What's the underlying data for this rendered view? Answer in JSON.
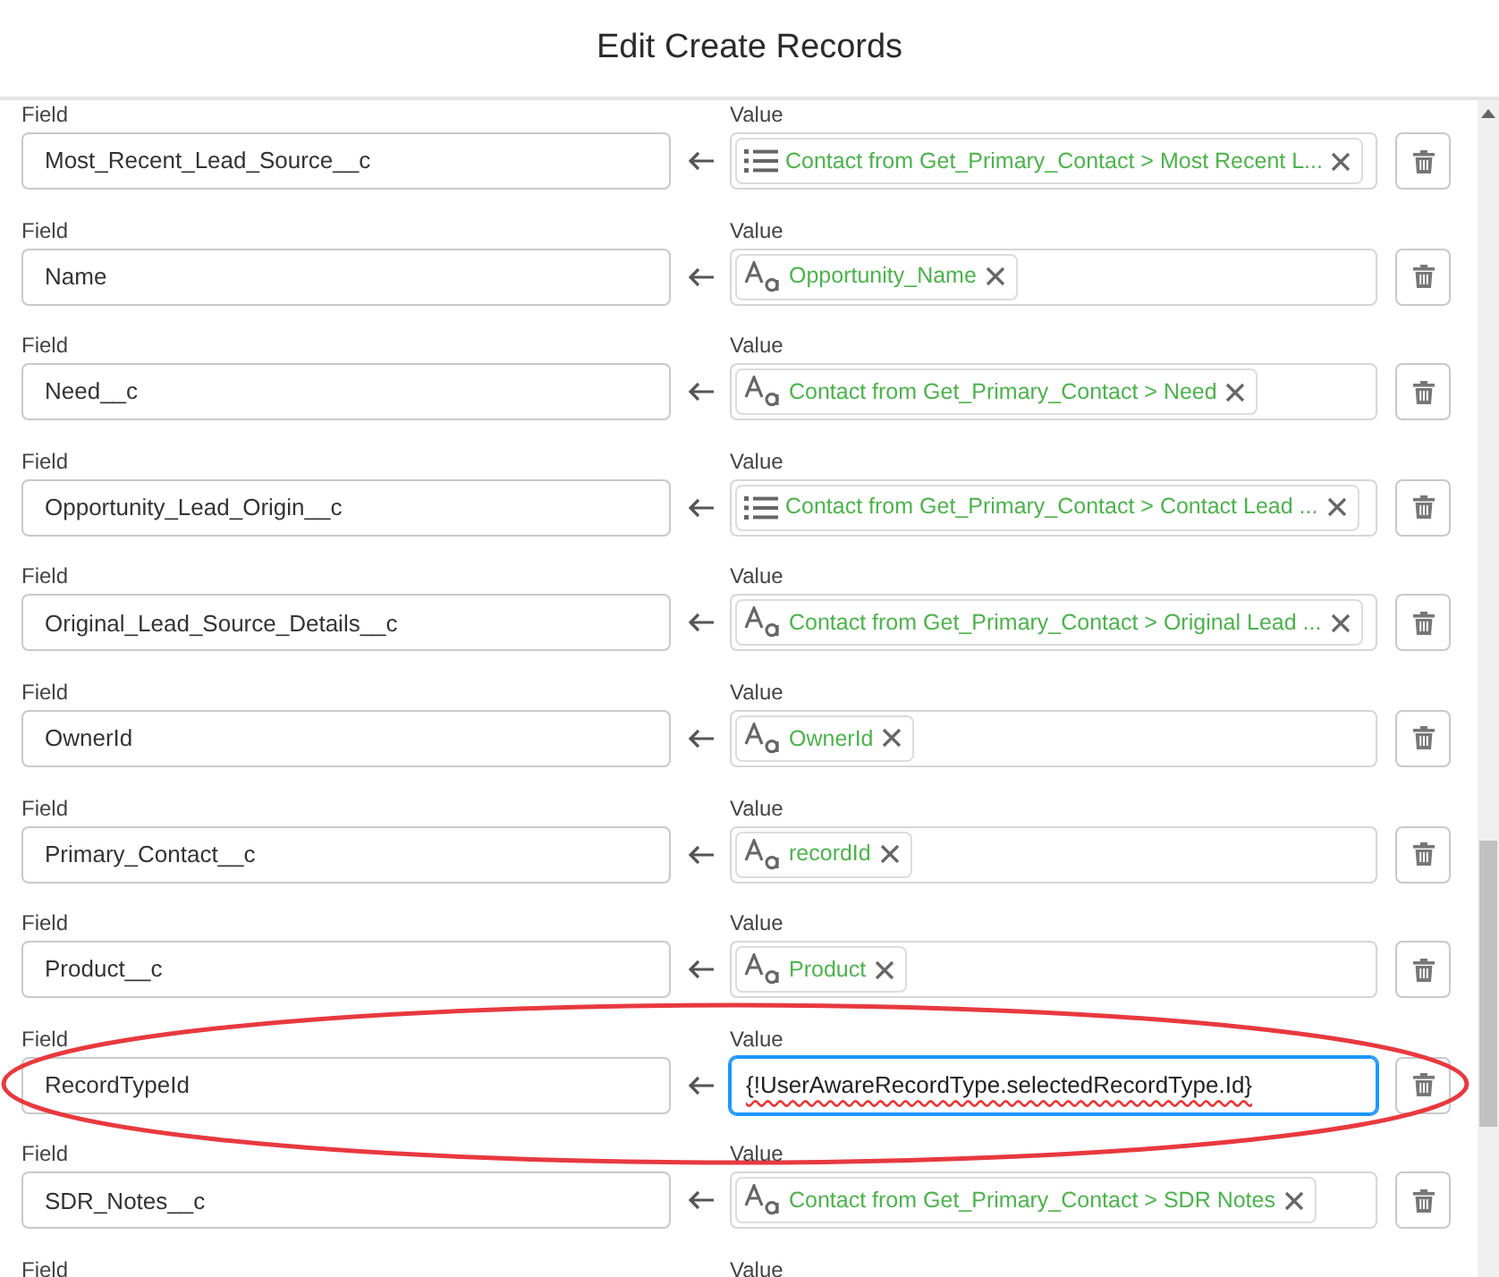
{
  "window": {
    "title": "Edit Create Records"
  },
  "rows": [
    {
      "field_label": "Field",
      "value_label": "Value",
      "field": "Most_Recent_Lead_Source__c",
      "value": {
        "kind": "picklist",
        "text": "Contact from Get_Primary_Contact > Most Recent L..."
      }
    },
    {
      "field_label": "Field",
      "value_label": "Value",
      "field": "Name",
      "value": {
        "kind": "text",
        "text": "Opportunity_Name"
      }
    },
    {
      "field_label": "Field",
      "value_label": "Value",
      "field": "Need__c",
      "value": {
        "kind": "text",
        "text": "Contact from Get_Primary_Contact > Need"
      }
    },
    {
      "field_label": "Field",
      "value_label": "Value",
      "field": "Opportunity_Lead_Origin__c",
      "value": {
        "kind": "picklist",
        "text": "Contact from Get_Primary_Contact > Contact Lead ..."
      }
    },
    {
      "field_label": "Field",
      "value_label": "Value",
      "field": "Original_Lead_Source_Details__c",
      "value": {
        "kind": "text",
        "text": "Contact from Get_Primary_Contact > Original Lead ..."
      }
    },
    {
      "field_label": "Field",
      "value_label": "Value",
      "field": "OwnerId",
      "value": {
        "kind": "text",
        "text": "OwnerId"
      }
    },
    {
      "field_label": "Field",
      "value_label": "Value",
      "field": "Primary_Contact__c",
      "value": {
        "kind": "text",
        "text": "recordId"
      }
    },
    {
      "field_label": "Field",
      "value_label": "Value",
      "field": "Product__c",
      "value": {
        "kind": "text",
        "text": "Product"
      }
    },
    {
      "field_label": "Field",
      "value_label": "Value",
      "field": "RecordTypeId",
      "value": {
        "kind": "formula",
        "text": "{!UserAwareRecordType.selectedRecordType.Id}",
        "focused": true,
        "spellcheck_error": true
      },
      "annotation": {
        "kind": "ellipse",
        "color": "#e8393f"
      }
    },
    {
      "field_label": "Field",
      "value_label": "Value",
      "field": "SDR_Notes__c",
      "value": {
        "kind": "text",
        "text": "Contact from Get_Primary_Contact > SDR Notes"
      }
    },
    {
      "field_label": "Field",
      "value_label": "Value"
    }
  ]
}
